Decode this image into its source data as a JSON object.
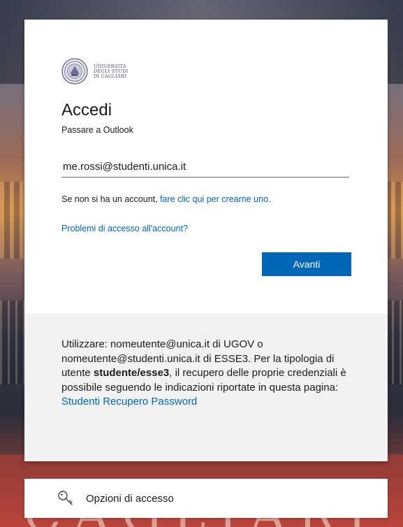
{
  "background": {
    "city_word": "CAGLIARI"
  },
  "logo": {
    "line1": "UNIVERSITÀ",
    "line2": "DEGLI STUDI",
    "line3": "DI CAGLIARI"
  },
  "signin": {
    "title": "Accedi",
    "subtitle": "Passare a Outlook",
    "email_value": "me.rossi@studenti.unica.it",
    "no_account_prefix": "Se non si ha un account, ",
    "no_account_link": "fare clic qui per crearne uno.",
    "problems_link": "Problemi di accesso all'account?",
    "next_label": "Avanti"
  },
  "info": {
    "part1": "Utilizzare: nomeutente@unica.it di UGOV o nomeutente@studenti.unica.it di ESSE3. Per la tipologia di utente ",
    "bold": "studente/esse3",
    "part2": ", il recupero delle proprie credenziali è possibile seguendo le indicazioni riportate in questa pagina: ",
    "link": "Studenti Recupero Password"
  },
  "options": {
    "label": "Opzioni di accesso"
  },
  "colors": {
    "accent": "#0067b8",
    "info_bg": "#f2f2f2"
  }
}
